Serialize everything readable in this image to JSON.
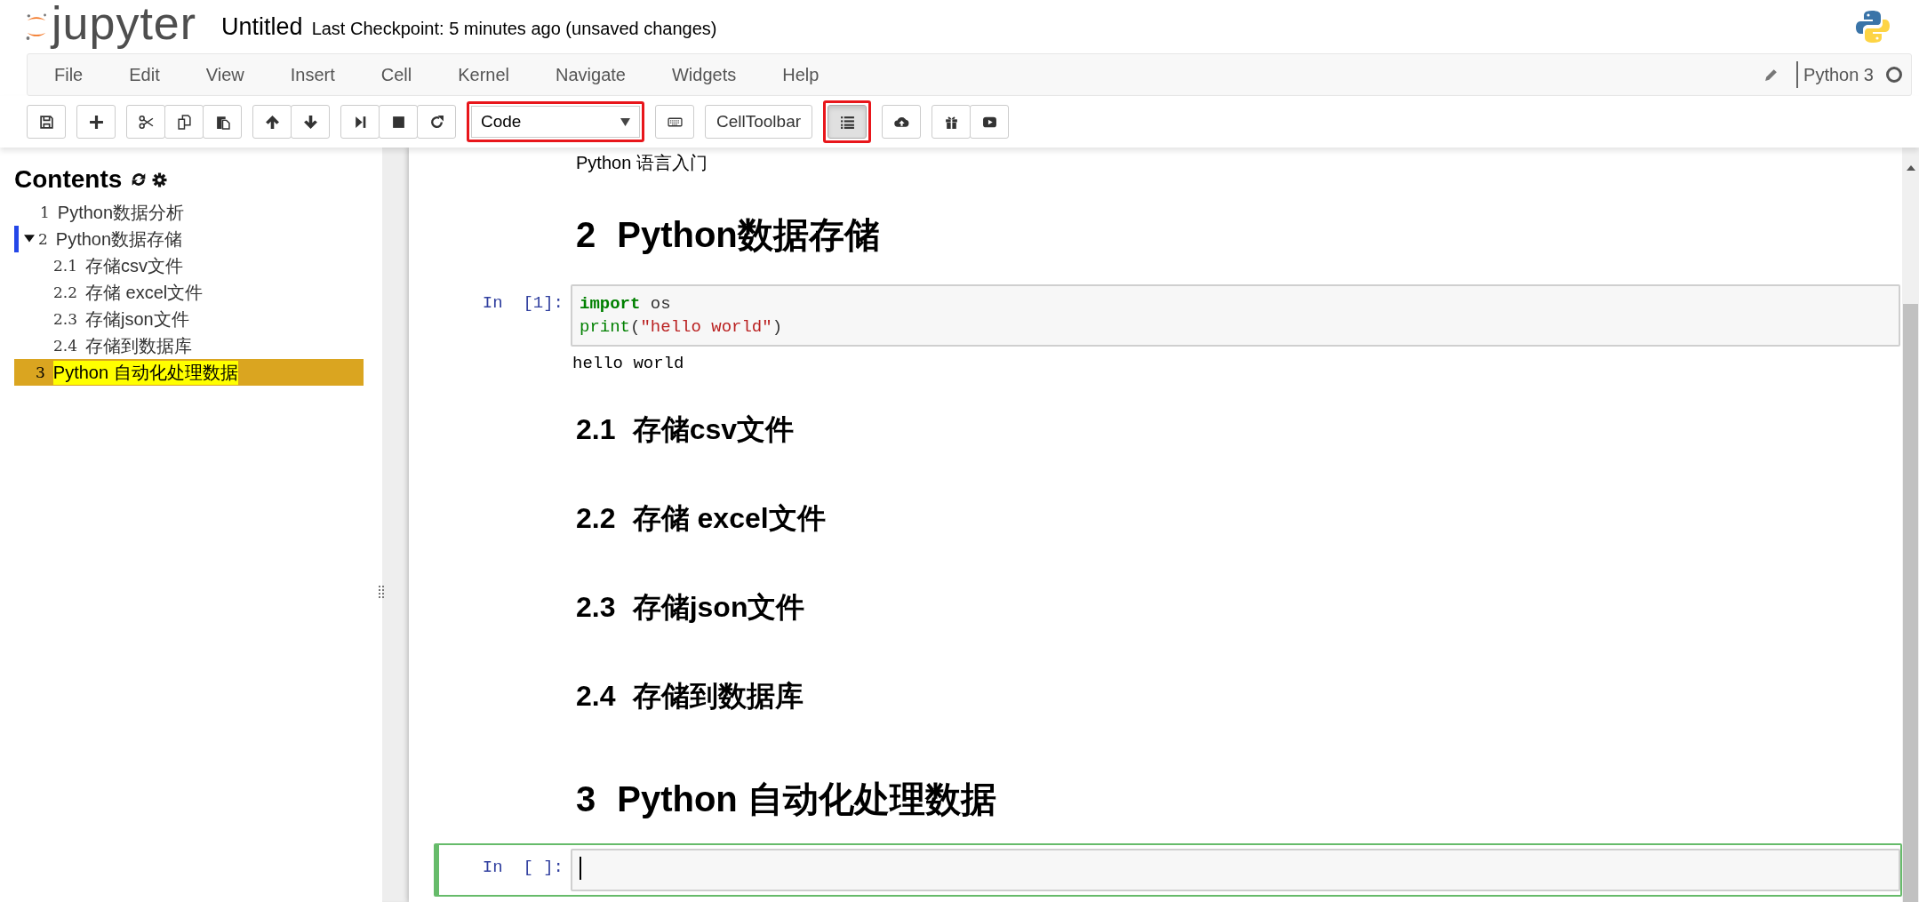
{
  "header": {
    "logo_text": "jupyter",
    "notebook_name": "Untitled",
    "checkpoint": "Last Checkpoint: 5 minutes ago (unsaved changes)"
  },
  "menu": [
    "File",
    "Edit",
    "View",
    "Insert",
    "Cell",
    "Kernel",
    "Navigate",
    "Widgets",
    "Help"
  ],
  "kernel": {
    "name": "Python 3",
    "busy": false
  },
  "toolbar": [
    {
      "items": [
        {
          "kind": "save",
          "pressed": false,
          "marked": false
        }
      ]
    },
    {
      "items": [
        {
          "kind": "add",
          "pressed": false,
          "marked": false
        }
      ]
    },
    {
      "items": [
        {
          "kind": "cut",
          "pressed": false,
          "marked": false
        },
        {
          "kind": "copy",
          "pressed": false,
          "marked": false
        },
        {
          "kind": "paste",
          "pressed": false,
          "marked": false
        }
      ]
    },
    {
      "items": [
        {
          "kind": "up",
          "pressed": false,
          "marked": false
        },
        {
          "kind": "down",
          "pressed": false,
          "marked": false
        }
      ]
    },
    {
      "items": [
        {
          "kind": "run",
          "pressed": false,
          "marked": false
        },
        {
          "kind": "stop",
          "pressed": false,
          "marked": false
        },
        {
          "kind": "restart",
          "pressed": false,
          "marked": false
        }
      ]
    },
    {
      "items": [
        {
          "kind": "select",
          "value": "Code",
          "pressed": false,
          "marked": true
        }
      ]
    },
    {
      "items": [
        {
          "kind": "keyboard",
          "pressed": false,
          "marked": false
        }
      ]
    },
    {
      "items": [
        {
          "kind": "text",
          "label": "CellToolbar",
          "pressed": false,
          "marked": false
        }
      ]
    },
    {
      "items": [
        {
          "kind": "list",
          "pressed": true,
          "marked": true
        }
      ]
    },
    {
      "items": [
        {
          "kind": "upload",
          "pressed": false,
          "marked": false
        }
      ]
    },
    {
      "items": [
        {
          "kind": "gift",
          "pressed": false,
          "marked": false
        },
        {
          "kind": "play",
          "pressed": false,
          "marked": false
        }
      ]
    }
  ],
  "toc": {
    "title": "Contents",
    "items": [
      {
        "number": "1",
        "title": "Python数据分析",
        "selected": false,
        "current": false
      },
      {
        "number": "2",
        "title": "Python数据存储",
        "selected": false,
        "current": true,
        "expanded": true,
        "children": [
          {
            "number": "2.1",
            "title": "存储csv文件",
            "selected": false,
            "current": false
          },
          {
            "number": "2.2",
            "title": "存储 excel文件",
            "selected": false,
            "current": false
          },
          {
            "number": "2.3",
            "title": "存储json文件",
            "selected": false,
            "current": false
          },
          {
            "number": "2.4",
            "title": "存储到数据库",
            "selected": false,
            "current": false
          }
        ]
      },
      {
        "number": "3",
        "title": "Python 自动化处理数据",
        "selected": true,
        "current": false
      }
    ]
  },
  "cells": [
    {
      "kind": "text",
      "text": "Python 语言入门"
    },
    {
      "kind": "h1",
      "number": "2",
      "title": "Python数据存储"
    },
    {
      "kind": "code",
      "prompt": "In  [1]:",
      "selected": false,
      "lines": [
        [
          {
            "kind": "keyword",
            "text": "import"
          },
          {
            "kind": "plain",
            "text": " os"
          }
        ],
        [
          {
            "kind": "builtin",
            "text": "print"
          },
          {
            "kind": "plain",
            "text": "("
          },
          {
            "kind": "string",
            "text": "\"hello world\""
          },
          {
            "kind": "plain",
            "text": ")"
          }
        ]
      ],
      "output": "hello world"
    },
    {
      "kind": "h2",
      "number": "2.1",
      "title": "存储csv文件"
    },
    {
      "kind": "h2",
      "number": "2.2",
      "title": "存储 excel文件"
    },
    {
      "kind": "h2",
      "number": "2.3",
      "title": "存储json文件"
    },
    {
      "kind": "h2",
      "number": "2.4",
      "title": "存储到数据库"
    },
    {
      "kind": "h1",
      "number": "3",
      "title": "Python 自动化处理数据"
    },
    {
      "kind": "code",
      "prompt": "In  [ ]:",
      "selected": true
    }
  ]
}
